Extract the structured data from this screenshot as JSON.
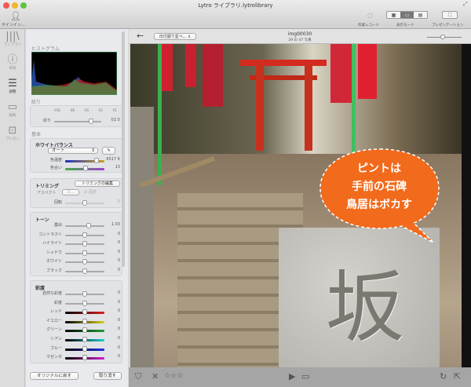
{
  "window": {
    "title": "Lytro ライブラリ.lytrolibrary"
  },
  "toolbar": {
    "signin": "サインイン...",
    "work_record": "作業レコード",
    "view_mode": "表示モード",
    "presentation": "プレゼンテーション"
  },
  "rail": [
    {
      "label": "ライブラリ",
      "icon": "library-icon"
    },
    {
      "label": "情報",
      "icon": "info-icon"
    },
    {
      "label": "調整",
      "icon": "adjust-icon"
    },
    {
      "label": "編集",
      "icon": "edit-icon"
    },
    {
      "label": "プレゼン",
      "icon": "present-icon"
    }
  ],
  "panel": {
    "histogram_title": "ヒストグラム",
    "aperture": {
      "title": "絞り",
      "label": "絞り",
      "ticks": [
        "f/16",
        "f/8",
        "f/4",
        "f/2",
        "f/1"
      ],
      "value": "f/2.0",
      "position": 0.78
    },
    "basic_title": "基本",
    "white_balance": {
      "title": "ホワイトバランス",
      "preset": "オート",
      "temp_label": "色温度",
      "temp_value": "6517 K",
      "temp_pos": 0.8,
      "tint_label": "色合い",
      "tint_value": "13",
      "tint_pos": 0.52
    },
    "crop": {
      "title": "トリミング",
      "edit_button": "トリミングの編集",
      "aspect_label": "アスペクト",
      "aspect_value": "カ...",
      "lock_label": "固定",
      "rotate_label": "回転",
      "rotate_value": "0"
    },
    "tone": {
      "title": "トーン",
      "rows": [
        {
          "label": "露出",
          "value": "1.03",
          "pos": 0.6
        },
        {
          "label": "コントラスト",
          "value": "0",
          "pos": 0.5
        },
        {
          "label": "ハイライト",
          "value": "0",
          "pos": 0.5
        },
        {
          "label": "シャドウ",
          "value": "0",
          "pos": 0.5
        },
        {
          "label": "ホワイト",
          "value": "0",
          "pos": 0.5
        },
        {
          "label": "ブラック",
          "value": "0",
          "pos": 0.5
        }
      ]
    },
    "saturation": {
      "title": "彩度",
      "rows": [
        {
          "label": "自然な彩度",
          "value": "0",
          "color": "#aaaaaa"
        },
        {
          "label": "彩度",
          "value": "0",
          "color": "#aaaaaa"
        },
        {
          "label": "レッド",
          "value": "0",
          "color": "#e02020"
        },
        {
          "label": "イエロー",
          "value": "0",
          "color": "#d8d020"
        },
        {
          "label": "グリーン",
          "value": "0",
          "color": "#20a030"
        },
        {
          "label": "シアン",
          "value": "0",
          "color": "#20d0d0"
        },
        {
          "label": "ブルー",
          "value": "0",
          "color": "#2030e0"
        },
        {
          "label": "マゼンタ",
          "value": "0",
          "color": "#d020d0"
        }
      ]
    },
    "revert_button": "オリジナルに戻す",
    "cancel_button": "取り消す"
  },
  "viewer": {
    "sort": "日付順で並べ...",
    "filename": "img00030",
    "counter": "29 の 47 写真",
    "zoom_pos": 0.45
  },
  "photo": {
    "bubble": [
      "ピントは",
      "手前の石碑",
      "鳥居はボカす"
    ],
    "carved_char": "坂",
    "bubble_color": "#f26a1b"
  }
}
